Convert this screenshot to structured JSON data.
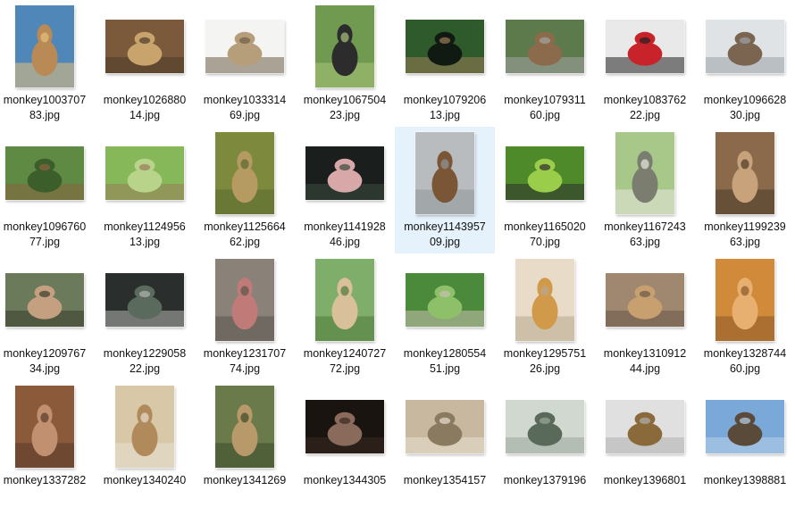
{
  "window": {
    "view": "Large icons"
  },
  "files": [
    {
      "name": "monkey100370783.jpg",
      "line1": "monkey1003707",
      "line2": "83.jpg",
      "orientation": "portrait",
      "palette": [
        "#4e87b8",
        "#b98a55",
        "#e6c07a"
      ],
      "selected": false
    },
    {
      "name": "monkey102688014.jpg",
      "line1": "monkey1026880",
      "line2": "14.jpg",
      "orientation": "landscape",
      "palette": [
        "#7a5a3a",
        "#c8a46c",
        "#4c3a2a"
      ],
      "selected": false
    },
    {
      "name": "monkey103331469.jpg",
      "line1": "monkey1033314",
      "line2": "69.jpg",
      "orientation": "landscape",
      "palette": [
        "#f4f4f2",
        "#b79e7a",
        "#6f5e4a"
      ],
      "selected": false
    },
    {
      "name": "monkey106750423.jpg",
      "line1": "monkey1067504",
      "line2": "23.jpg",
      "orientation": "portrait",
      "palette": [
        "#6f9a4f",
        "#2c2c2c",
        "#a7c47a"
      ],
      "selected": false
    },
    {
      "name": "monkey107920613.jpg",
      "line1": "monkey1079206",
      "line2": "13.jpg",
      "orientation": "landscape",
      "palette": [
        "#2f5a2c",
        "#111a12",
        "#9b7b56"
      ],
      "selected": false
    },
    {
      "name": "monkey107931160.jpg",
      "line1": "monkey1079311",
      "line2": "60.jpg",
      "orientation": "landscape",
      "palette": [
        "#5d7a4c",
        "#8b6b4b",
        "#a2a2a2"
      ],
      "selected": false
    },
    {
      "name": "monkey108376222.jpg",
      "line1": "monkey1083762",
      "line2": "22.jpg",
      "orientation": "landscape",
      "palette": [
        "#e9e9e9",
        "#c8232a",
        "#222222"
      ],
      "selected": false
    },
    {
      "name": "monkey109662830.jpg",
      "line1": "monkey1096628",
      "line2": "30.jpg",
      "orientation": "landscape",
      "palette": [
        "#dfe3e6",
        "#7b6550",
        "#9aa3a8"
      ],
      "selected": false
    },
    {
      "name": "monkey109676077.jpg",
      "line1": "monkey1096760",
      "line2": "77.jpg",
      "orientation": "landscape",
      "palette": [
        "#5e8a44",
        "#3c5e2a",
        "#8a6440"
      ],
      "selected": false
    },
    {
      "name": "monkey112495613.jpg",
      "line1": "monkey1124956",
      "line2": "13.jpg",
      "orientation": "landscape",
      "palette": [
        "#86b85a",
        "#b8d48a",
        "#9a7a5a"
      ],
      "selected": false
    },
    {
      "name": "monkey112566462.jpg",
      "line1": "monkey1125664",
      "line2": "62.jpg",
      "orientation": "portrait",
      "palette": [
        "#7d8a3e",
        "#b59a62",
        "#5a6a2e"
      ],
      "selected": false
    },
    {
      "name": "monkey114192846.jpg",
      "line1": "monkey1141928",
      "line2": "46.jpg",
      "orientation": "landscape",
      "palette": [
        "#1a1f1d",
        "#d8a8a8",
        "#3a4a3e"
      ],
      "selected": false
    },
    {
      "name": "monkey114395709.jpg",
      "line1": "monkey1143957",
      "line2": "09.jpg",
      "orientation": "portrait",
      "palette": [
        "#b9bcbf",
        "#7a5636",
        "#8f9599"
      ],
      "selected": true
    },
    {
      "name": "monkey116502070.jpg",
      "line1": "monkey1165020",
      "line2": "70.jpg",
      "orientation": "landscape",
      "palette": [
        "#4f8a2a",
        "#9acd4a",
        "#2e2e2e"
      ],
      "selected": false
    },
    {
      "name": "monkey116724363.jpg",
      "line1": "monkey1167243",
      "line2": "63.jpg",
      "orientation": "portrait",
      "palette": [
        "#a8c88a",
        "#7b7e6f",
        "#e8e8e0"
      ],
      "selected": false
    },
    {
      "name": "monkey119923963.jpg",
      "line1": "monkey1199239",
      "line2": "63.jpg",
      "orientation": "portrait",
      "palette": [
        "#8a6a4a",
        "#c8a27a",
        "#4a3a2a"
      ],
      "selected": false
    },
    {
      "name": "monkey120976734.jpg",
      "line1": "monkey1209767",
      "line2": "34.jpg",
      "orientation": "landscape",
      "palette": [
        "#6a7a5a",
        "#c4a080",
        "#3c3c30"
      ],
      "selected": false
    },
    {
      "name": "monkey122905822.jpg",
      "line1": "monkey1229058",
      "line2": "22.jpg",
      "orientation": "landscape",
      "palette": [
        "#2a2e2c",
        "#5a6a5c",
        "#b0b4b0"
      ],
      "selected": false
    },
    {
      "name": "monkey123170774.jpg",
      "line1": "monkey1231707",
      "line2": "74.jpg",
      "orientation": "portrait",
      "palette": [
        "#8a8278",
        "#c07a78",
        "#5a554e"
      ],
      "selected": false
    },
    {
      "name": "monkey124072772.jpg",
      "line1": "monkey1240727",
      "line2": "72.jpg",
      "orientation": "portrait",
      "palette": [
        "#7fae6a",
        "#d8c09a",
        "#4e7a3a"
      ],
      "selected": false
    },
    {
      "name": "monkey128055451.jpg",
      "line1": "monkey1280554",
      "line2": "51.jpg",
      "orientation": "landscape",
      "palette": [
        "#4a8a3a",
        "#8ec06a",
        "#c8c0b0"
      ],
      "selected": false
    },
    {
      "name": "monkey129575126.jpg",
      "line1": "monkey1295751",
      "line2": "26.jpg",
      "orientation": "portrait",
      "palette": [
        "#e8dcc8",
        "#d09a4a",
        "#b8a890"
      ],
      "selected": false
    },
    {
      "name": "monkey131091244.jpg",
      "line1": "monkey1310912",
      "line2": "44.jpg",
      "orientation": "landscape",
      "palette": [
        "#a08870",
        "#c8a070",
        "#6a5848"
      ],
      "selected": false
    },
    {
      "name": "monkey132874460.jpg",
      "line1": "monkey1328744",
      "line2": "60.jpg",
      "orientation": "portrait",
      "palette": [
        "#d08a3a",
        "#e8b070",
        "#8a5a2a"
      ],
      "selected": false
    },
    {
      "name": "monkey1337282",
      "line1": "monkey1337282",
      "line2": "",
      "orientation": "portrait",
      "palette": [
        "#8a5a3a",
        "#c09070",
        "#5a3a2a"
      ],
      "selected": false
    },
    {
      "name": "monkey1340240",
      "line1": "monkey1340240",
      "line2": "",
      "orientation": "portrait",
      "palette": [
        "#d8c8a8",
        "#b08a5a",
        "#e8e0d0"
      ],
      "selected": false
    },
    {
      "name": "monkey1341269",
      "line1": "monkey1341269",
      "line2": "",
      "orientation": "portrait",
      "palette": [
        "#6a7a4a",
        "#b89a6a",
        "#3a4a2a"
      ],
      "selected": false
    },
    {
      "name": "monkey1344305",
      "line1": "monkey1344305",
      "line2": "",
      "orientation": "landscape",
      "palette": [
        "#1a1410",
        "#8a6a5a",
        "#3a2a20"
      ],
      "selected": false
    },
    {
      "name": "monkey1354157",
      "line1": "monkey1354157",
      "line2": "",
      "orientation": "landscape",
      "palette": [
        "#c8b8a0",
        "#8a7a60",
        "#e8e0d0"
      ],
      "selected": false
    },
    {
      "name": "monkey1379196",
      "line1": "monkey1379196",
      "line2": "",
      "orientation": "landscape",
      "palette": [
        "#d0d8d0",
        "#5a6a5a",
        "#9aa89a"
      ],
      "selected": false
    },
    {
      "name": "monkey1396801",
      "line1": "monkey1396801",
      "line2": "",
      "orientation": "landscape",
      "palette": [
        "#e0e0e0",
        "#8a6a3a",
        "#b0b0b0"
      ],
      "selected": false
    },
    {
      "name": "monkey1398881",
      "line1": "monkey1398881",
      "line2": "",
      "orientation": "landscape",
      "palette": [
        "#7aa8d8",
        "#5a4a3a",
        "#b8d0e8"
      ],
      "selected": false
    }
  ]
}
